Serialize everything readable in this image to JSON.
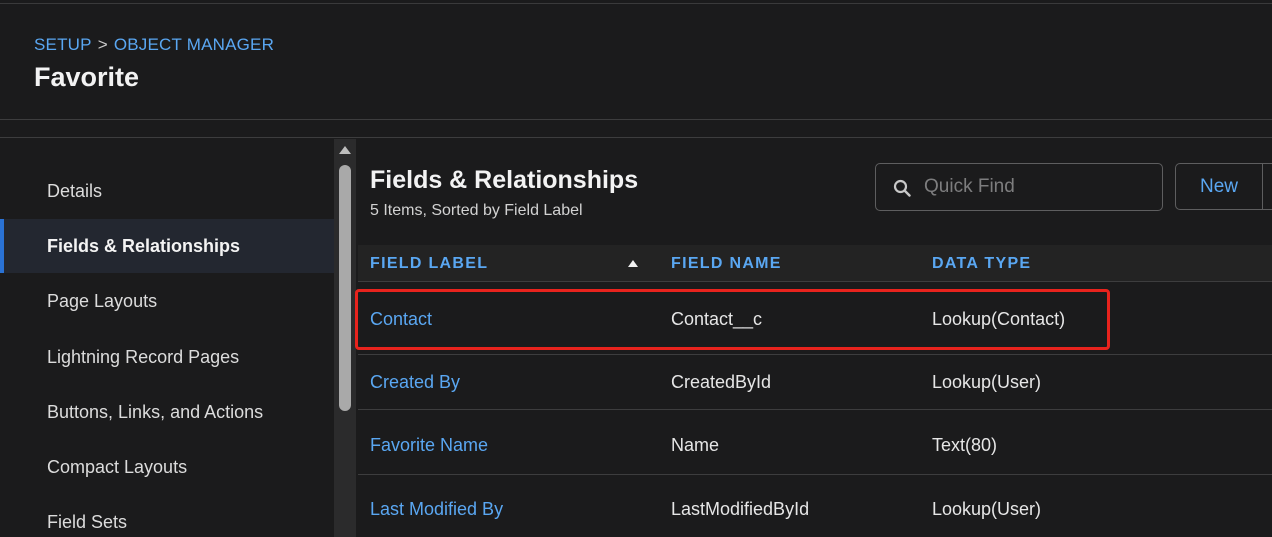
{
  "breadcrumb": {
    "setup": "SETUP",
    "separator": ">",
    "object_manager": "OBJECT MANAGER"
  },
  "page": {
    "title": "Favorite"
  },
  "sidebar": {
    "items": [
      {
        "label": "Details",
        "active": false
      },
      {
        "label": "Fields & Relationships",
        "active": true
      },
      {
        "label": "Page Layouts",
        "active": false
      },
      {
        "label": "Lightning Record Pages",
        "active": false
      },
      {
        "label": "Buttons, Links, and Actions",
        "active": false
      },
      {
        "label": "Compact Layouts",
        "active": false
      },
      {
        "label": "Field Sets",
        "active": false
      }
    ]
  },
  "section": {
    "title": "Fields & Relationships",
    "subtitle": "5 Items, Sorted by Field Label"
  },
  "search": {
    "placeholder": "Quick Find",
    "value": ""
  },
  "toolbar": {
    "new_label": "New"
  },
  "table": {
    "columns": [
      "FIELD LABEL",
      "FIELD NAME",
      "DATA TYPE"
    ],
    "sorted_column": "FIELD LABEL",
    "sort_direction": "ascending",
    "rows": [
      {
        "label": "Contact",
        "name": "Contact__c",
        "type": "Lookup(Contact)",
        "highlighted": true
      },
      {
        "label": "Created By",
        "name": "CreatedById",
        "type": "Lookup(User)",
        "highlighted": false
      },
      {
        "label": "Favorite Name",
        "name": "Name",
        "type": "Text(80)",
        "highlighted": false
      },
      {
        "label": "Last Modified By",
        "name": "LastModifiedById",
        "type": "Lookup(User)",
        "highlighted": false
      }
    ]
  },
  "colors": {
    "accent": "#5aa7f2",
    "highlight_box": "#e8231d",
    "active_bar": "#2a72d4"
  }
}
